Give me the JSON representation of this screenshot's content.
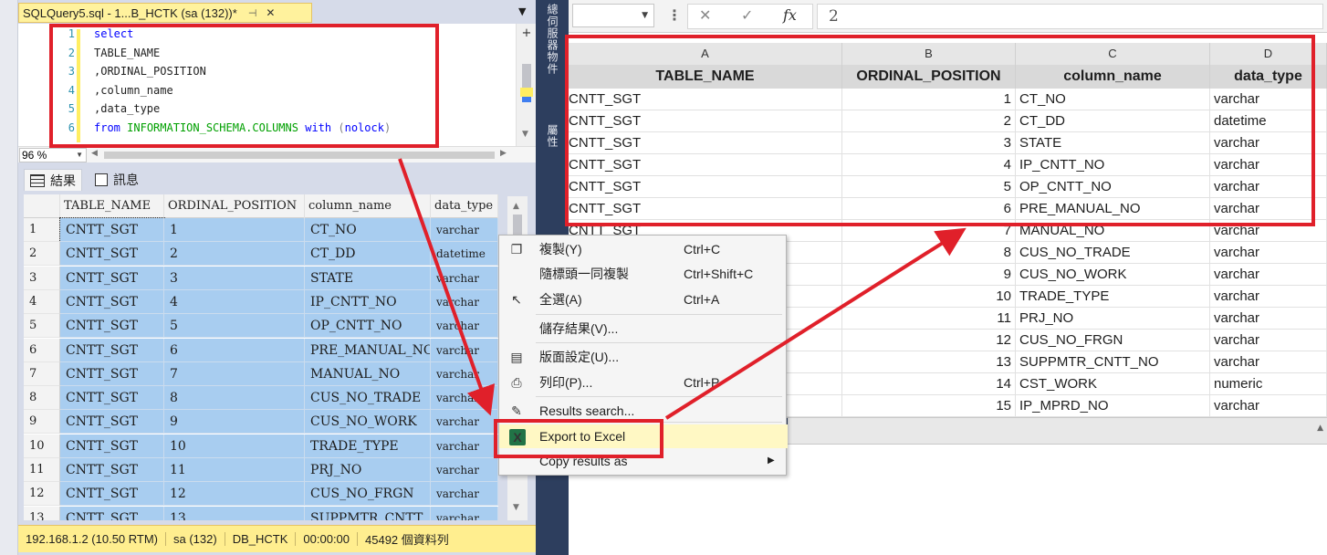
{
  "ssms": {
    "tab_title": "SQLQuery5.sql - 1...B_HCTK (sa (132))*",
    "tab_pin": "⊣",
    "tab_close": "✕",
    "code_lines": [
      {
        "num": "1",
        "text": "select"
      },
      {
        "num": "2",
        "text": "TABLE_NAME"
      },
      {
        "num": "3",
        "text": ",ORDINAL_POSITION"
      },
      {
        "num": "4",
        "text": ",column_name"
      },
      {
        "num": "5",
        "text": ",data_type"
      },
      {
        "num": "6",
        "from": "from",
        "table": "INFORMATION_SCHEMA.COLUMNS",
        "with": "with",
        "paren_open": "(",
        "nolock": "nolock",
        "paren_close": ")"
      }
    ],
    "zoom": "96 %",
    "result_tabs": [
      "結果",
      "訊息"
    ],
    "grid": {
      "headers": [
        "TABLE_NAME",
        "ORDINAL_POSITION",
        "column_name",
        "data_type"
      ],
      "rows": [
        [
          "1",
          "CNTT_SGT",
          "1",
          "CT_NO",
          "varchar"
        ],
        [
          "2",
          "CNTT_SGT",
          "2",
          "CT_DD",
          "datetime"
        ],
        [
          "3",
          "CNTT_SGT",
          "3",
          "STATE",
          "varchar"
        ],
        [
          "4",
          "CNTT_SGT",
          "4",
          "IP_CNTT_NO",
          "varchar"
        ],
        [
          "5",
          "CNTT_SGT",
          "5",
          "OP_CNTT_NO",
          "varchar"
        ],
        [
          "6",
          "CNTT_SGT",
          "6",
          "PRE_MANUAL_NO",
          "varchar"
        ],
        [
          "7",
          "CNTT_SGT",
          "7",
          "MANUAL_NO",
          "varchar"
        ],
        [
          "8",
          "CNTT_SGT",
          "8",
          "CUS_NO_TRADE",
          "varchar"
        ],
        [
          "9",
          "CNTT_SGT",
          "9",
          "CUS_NO_WORK",
          "varchar"
        ],
        [
          "10",
          "CNTT_SGT",
          "10",
          "TRADE_TYPE",
          "varchar"
        ],
        [
          "11",
          "CNTT_SGT",
          "11",
          "PRJ_NO",
          "varchar"
        ],
        [
          "12",
          "CNTT_SGT",
          "12",
          "CUS_NO_FRGN",
          "varchar"
        ],
        [
          "13",
          "CNTT_SGT",
          "13",
          "SUPPMTR_CNTT",
          "varchar"
        ]
      ]
    },
    "status": [
      "192.168.1.2 (10.50 RTM)",
      "sa (132)",
      "DB_HCTK",
      "00:00:00",
      "45492 個資料列"
    ]
  },
  "side_labels": [
    "總伺服器物件",
    "屬性"
  ],
  "context_menu": {
    "items": [
      {
        "label": "複製(Y)",
        "shortcut": "Ctrl+C",
        "icon": "copy-icon"
      },
      {
        "label": "隨標頭一同複製",
        "shortcut": "Ctrl+Shift+C",
        "icon": ""
      },
      {
        "label": "全選(A)",
        "shortcut": "Ctrl+A",
        "icon": "select-all-icon"
      },
      {
        "label": "儲存結果(V)...",
        "shortcut": "",
        "icon": ""
      },
      {
        "label": "版面設定(U)...",
        "shortcut": "",
        "icon": "page-setup-icon"
      },
      {
        "label": "列印(P)...",
        "shortcut": "Ctrl+P",
        "icon": "print-icon"
      },
      {
        "label": "Results search...",
        "shortcut": "",
        "icon": "wrench-icon"
      },
      {
        "label": "Export to Excel",
        "shortcut": "",
        "icon": "excel-icon"
      },
      {
        "label": "Copy results as",
        "shortcut": "",
        "icon": ""
      }
    ]
  },
  "excel": {
    "formula_value": "2",
    "formula_icons": [
      "✕",
      "✓",
      "fx"
    ],
    "columns": [
      "A",
      "B",
      "C",
      "D"
    ],
    "header_row": [
      "TABLE_NAME",
      "ORDINAL_POSITION",
      "column_name",
      "data_type"
    ],
    "rows": [
      [
        "CNTT_SGT",
        "1",
        "CT_NO",
        "varchar"
      ],
      [
        "CNTT_SGT",
        "2",
        "CT_DD",
        "datetime"
      ],
      [
        "CNTT_SGT",
        "3",
        "STATE",
        "varchar"
      ],
      [
        "CNTT_SGT",
        "4",
        "IP_CNTT_NO",
        "varchar"
      ],
      [
        "CNTT_SGT",
        "5",
        "OP_CNTT_NO",
        "varchar"
      ],
      [
        "CNTT_SGT",
        "6",
        "PRE_MANUAL_NO",
        "varchar"
      ],
      [
        "CNTT_SGT",
        "7",
        "MANUAL_NO",
        "varchar"
      ],
      [
        "",
        "8",
        "CUS_NO_TRADE",
        "varchar"
      ],
      [
        "",
        "9",
        "CUS_NO_WORK",
        "varchar"
      ],
      [
        "",
        "10",
        "TRADE_TYPE",
        "varchar"
      ],
      [
        "",
        "11",
        "PRJ_NO",
        "varchar"
      ],
      [
        "",
        "12",
        "CUS_NO_FRGN",
        "varchar"
      ],
      [
        "",
        "13",
        "SUPPMTR_CNTT_NO",
        "varchar"
      ],
      [
        "",
        "14",
        "CST_WORK",
        "numeric"
      ],
      [
        "",
        "15",
        "IP_MPRD_NO",
        "varchar"
      ]
    ]
  },
  "colors": {
    "annotation_red": "#e0202a",
    "selection_blue": "#a8cdf0",
    "status_yellow": "#ffee8f",
    "excel_green": "#217346"
  }
}
